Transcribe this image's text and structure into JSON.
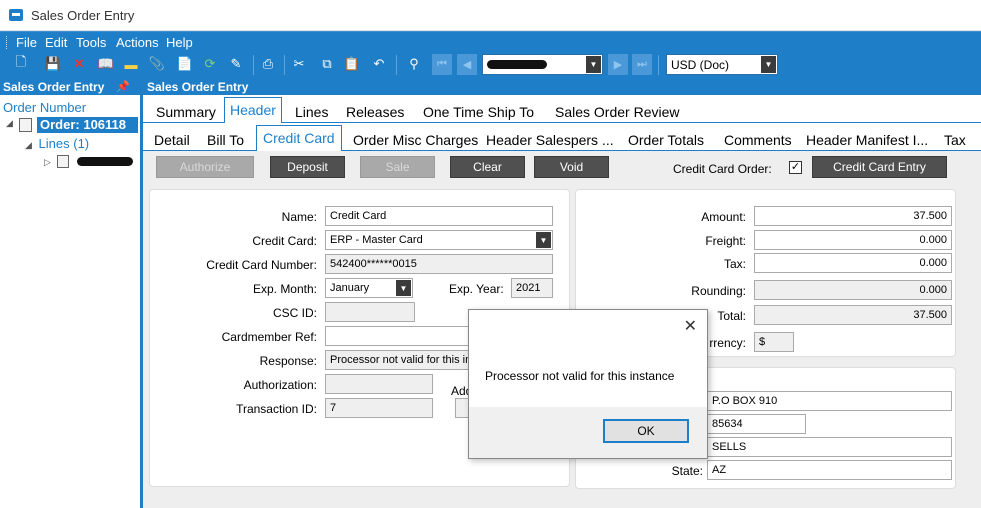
{
  "window": {
    "title": "Sales Order Entry"
  },
  "menu": [
    "File",
    "Edit",
    "Tools",
    "Actions",
    "Help"
  ],
  "toolbar": {
    "record_value": "",
    "currency": "USD (Doc)"
  },
  "left_panel": {
    "title": "Sales Order Entry",
    "tree_header": "Order Number",
    "order_label": "Order: 106118",
    "lines_label": "Lines (1)"
  },
  "main": {
    "title": "Sales Order Entry"
  },
  "tabs_top": [
    "Summary",
    "Header",
    "Lines",
    "Releases",
    "One Time Ship To",
    "Sales Order Review"
  ],
  "tabs_top_active": "Header",
  "tabs_sub": [
    "Detail",
    "Bill To",
    "Credit Card",
    "Order Misc Charges",
    "Header  Salespers ...",
    "Order Totals",
    "Comments",
    "Header  Manifest  I...",
    "Tax"
  ],
  "tabs_sub_active": "Credit Card",
  "actions": {
    "authorize": "Authorize",
    "deposit": "Deposit",
    "sale": "Sale",
    "clear": "Clear",
    "void": "Void",
    "cc_order_label": "Credit Card Order:",
    "cc_order_checked": true,
    "cc_entry": "Credit Card Entry"
  },
  "form": {
    "name_label": "Name:",
    "name_value": "Credit Card",
    "card_label": "Credit Card:",
    "card_value": "ERP - Master Card",
    "number_label": "Credit Card Number:",
    "number_value": "542400******0015",
    "month_label": "Exp. Month:",
    "month_value": "January",
    "year_label": "Exp. Year:",
    "year_value": "2021",
    "csc_label": "CSC ID:",
    "csc_value": "",
    "ref_label": "Cardmember Ref:",
    "ref_value": "",
    "response_label": "Response:",
    "response_value": "Processor not valid for this instance",
    "auth_label": "Authorization:",
    "auth_value": "",
    "txn_label": "Transaction ID:",
    "txn_value": "7",
    "addr_label_partial": "Add"
  },
  "totals": {
    "amount_label": "Amount:",
    "amount_value": "37.500",
    "freight_label": "Freight:",
    "freight_value": "0.000",
    "tax_label": "Tax:",
    "tax_value": "0.000",
    "rounding_label": "Rounding:",
    "rounding_value": "0.000",
    "total_label": "Total:",
    "total_value": "37.500",
    "currency_label": "rrency:",
    "currency_value": "$"
  },
  "address": {
    "line1_value": "P.O BOX 910",
    "zip_value": "85634",
    "city_value": "SELLS",
    "state_label": "State:",
    "state_value": "AZ"
  },
  "dialog": {
    "message": "Processor not valid for this instance",
    "ok_label": "OK",
    "close_glyph": "✕"
  }
}
